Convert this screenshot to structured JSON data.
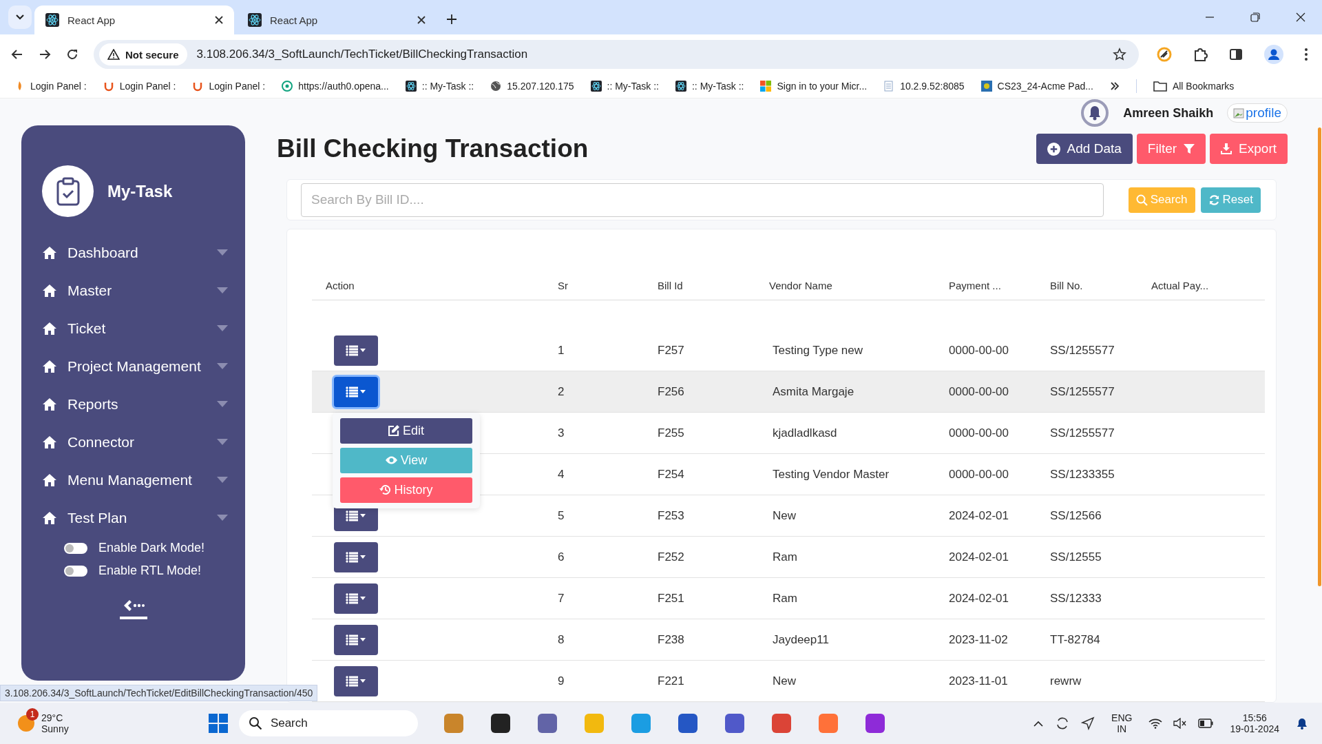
{
  "browser": {
    "tabs": [
      {
        "title": "React App",
        "selected": true
      },
      {
        "title": "React App",
        "selected": false
      }
    ],
    "security": "Not secure",
    "url": "3.108.206.34/3_SoftLaunch/TechTicket/BillCheckingTransaction",
    "bookmarks": [
      {
        "label": "Login Panel :",
        "kind": "flame"
      },
      {
        "label": "Login Panel :",
        "kind": "u"
      },
      {
        "label": "Login Panel :",
        "kind": "u"
      },
      {
        "label": "https://auth0.opena...",
        "kind": "chat"
      },
      {
        "label": ":: My-Task ::",
        "kind": "atom"
      },
      {
        "label": "15.207.120.175",
        "kind": "globe"
      },
      {
        "label": ":: My-Task ::",
        "kind": "atom"
      },
      {
        "label": ":: My-Task ::",
        "kind": "atom"
      },
      {
        "label": "Sign in to your Micr...",
        "kind": "windows"
      },
      {
        "label": "10.2.9.52:8085",
        "kind": "doc"
      },
      {
        "label": "CS23_24-Acme Pad...",
        "kind": "tile"
      }
    ],
    "all_bookmarks": "All Bookmarks"
  },
  "sidebar": {
    "brand": "My-Task",
    "items": [
      {
        "label": "Dashboard"
      },
      {
        "label": "Master"
      },
      {
        "label": "Ticket"
      },
      {
        "label": "Project Management"
      },
      {
        "label": "Reports"
      },
      {
        "label": "Connector"
      },
      {
        "label": "Menu Management"
      },
      {
        "label": "Test Plan"
      }
    ],
    "toggles": [
      {
        "label": "Enable Dark Mode!",
        "on": false
      },
      {
        "label": "Enable RTL Mode!",
        "on": false
      }
    ]
  },
  "user": {
    "name": "Amreen Shaikh",
    "avatar_alt": "profile"
  },
  "title": "Bill Checking Transaction",
  "actions": [
    {
      "label": "Add Data",
      "kind": "add"
    },
    {
      "label": "Filter",
      "kind": "filter"
    },
    {
      "label": "Export",
      "kind": "export"
    }
  ],
  "search": {
    "placeholder": "Search By Bill ID....",
    "buttons": [
      {
        "label": "Search",
        "kind": "search"
      },
      {
        "label": "Reset",
        "kind": "reset"
      }
    ]
  },
  "table": {
    "columns": [
      "Action",
      "Sr",
      "Bill Id",
      "Vendor Name",
      "Payment ...",
      "Bill No.",
      "Actual Pay..."
    ],
    "rows": [
      {
        "sr": "1",
        "bill_id": "F257",
        "vendor": "Testing Type new",
        "payment": "0000-00-00",
        "bill_no": "SS/1255577",
        "selected": false
      },
      {
        "sr": "2",
        "bill_id": "F256",
        "vendor": "Asmita Margaje",
        "payment": "0000-00-00",
        "bill_no": "SS/1255577",
        "selected": true
      },
      {
        "sr": "3",
        "bill_id": "F255",
        "vendor": "kjadladlkasd",
        "payment": "0000-00-00",
        "bill_no": "SS/1255577",
        "selected": false
      },
      {
        "sr": "4",
        "bill_id": "F254",
        "vendor": "Testing Vendor Master",
        "payment": "0000-00-00",
        "bill_no": "SS/1233355",
        "selected": false
      },
      {
        "sr": "5",
        "bill_id": "F253",
        "vendor": "New",
        "payment": "2024-02-01",
        "bill_no": "SS/12566",
        "selected": false
      },
      {
        "sr": "6",
        "bill_id": "F252",
        "vendor": "Ram",
        "payment": "2024-02-01",
        "bill_no": "SS/12555",
        "selected": false
      },
      {
        "sr": "7",
        "bill_id": "F251",
        "vendor": "Ram",
        "payment": "2024-02-01",
        "bill_no": "SS/12333",
        "selected": false
      },
      {
        "sr": "8",
        "bill_id": "F238",
        "vendor": "Jaydeep11",
        "payment": "2023-11-02",
        "bill_no": "TT-82784",
        "selected": false
      },
      {
        "sr": "9",
        "bill_id": "F221",
        "vendor": "New",
        "payment": "2023-11-01",
        "bill_no": "rewrw",
        "selected": false
      }
    ],
    "menu": [
      {
        "label": "Edit",
        "kind": "edit"
      },
      {
        "label": "View",
        "kind": "view"
      },
      {
        "label": "History",
        "kind": "history"
      }
    ]
  },
  "status_url": "3.108.206.34/3_SoftLaunch/TechTicket/EditBillCheckingTransaction/450",
  "taskbar": {
    "weather_badge": "1",
    "temperature": "29°C",
    "condition": "Sunny",
    "search": "Search",
    "lang": "ENG",
    "region": "IN",
    "time": "15:56",
    "date": "19-01-2024"
  }
}
